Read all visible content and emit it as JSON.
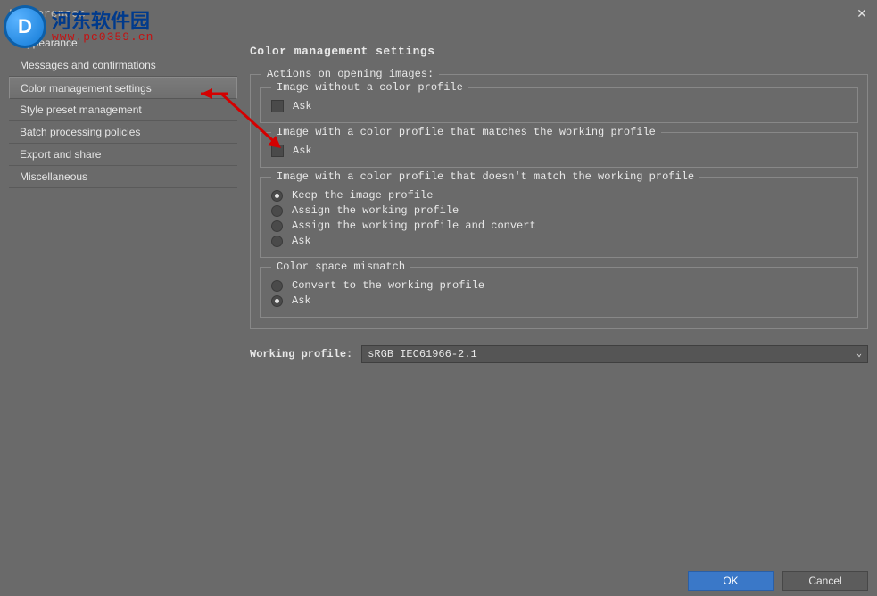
{
  "window": {
    "title": "Preferences"
  },
  "sidebar": {
    "items": [
      {
        "label": "Appearance"
      },
      {
        "label": "Messages and confirmations"
      },
      {
        "label": "Color management settings"
      },
      {
        "label": "Style preset management"
      },
      {
        "label": "Batch processing policies"
      },
      {
        "label": "Export and share"
      },
      {
        "label": "Miscellaneous"
      }
    ],
    "selected_index": 2
  },
  "main": {
    "heading": "Color management settings",
    "actions_group": {
      "legend": "Actions on opening images:",
      "group1": {
        "legend": "Image without a color profile",
        "ask_label": "Ask"
      },
      "group2": {
        "legend": "Image with a color profile that matches the working profile",
        "ask_label": "Ask"
      },
      "group3": {
        "legend": "Image with a color profile that doesn't match the working profile",
        "options": [
          "Keep the image profile",
          "Assign the working profile",
          "Assign the working profile and convert",
          "Ask"
        ],
        "selected": 0
      },
      "group4": {
        "legend": "Color space mismatch",
        "options": [
          "Convert to the working profile",
          "Ask"
        ],
        "selected": 1
      }
    },
    "working_profile": {
      "label": "Working profile:",
      "value": "sRGB IEC61966-2.1"
    }
  },
  "footer": {
    "ok": "OK",
    "cancel": "Cancel"
  },
  "watermark": {
    "logo_letter": "D",
    "cn": "河东软件园",
    "url": "www.pc0359.cn"
  }
}
